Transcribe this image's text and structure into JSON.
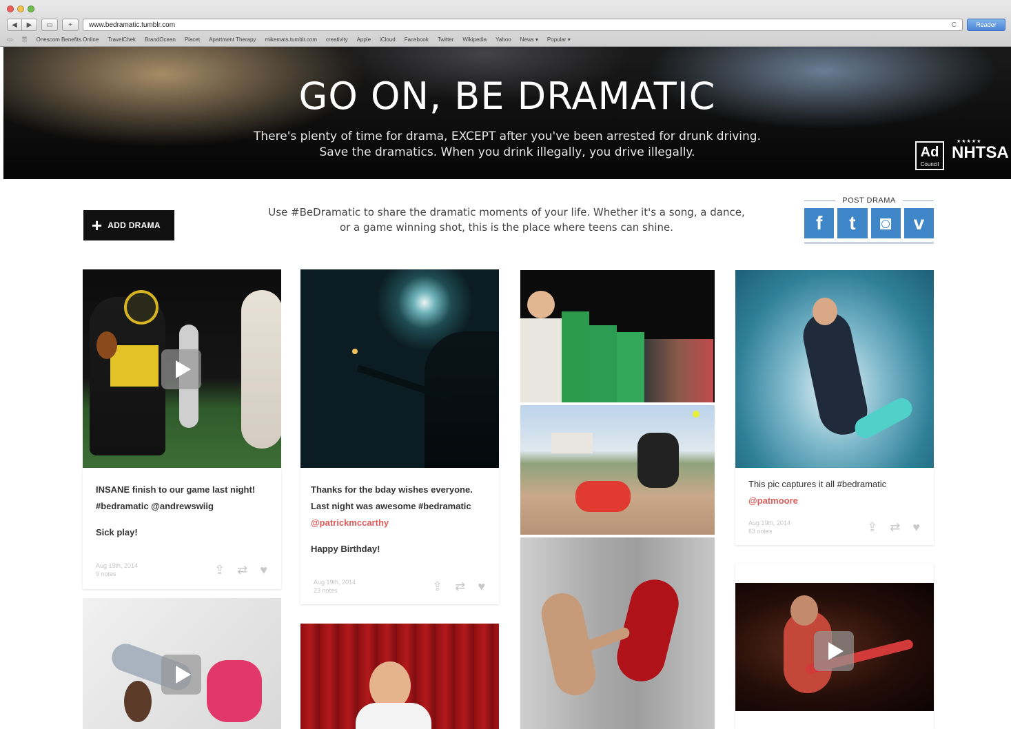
{
  "browser": {
    "url": "www.bedramatic.tumblr.com",
    "reader": "Reader",
    "bookmarks": [
      "Onescom Benefits Online",
      "TravelChek",
      "BrandOcean",
      "Placet",
      "Apartment Therapy",
      "mikemats.tumblr.com",
      "creativity",
      "Apple",
      "iCloud",
      "Facebook",
      "Twitter",
      "Wikipedia",
      "Yahoo",
      "News ▾",
      "Popular ▾"
    ]
  },
  "hero": {
    "title": "GO ON, BE DRAMATIC",
    "line1": "There's plenty of time for drama, EXCEPT after you've been arrested for drunk driving.",
    "line2": "Save the dramatics. When you drink illegally, you drive illegally.",
    "logo_ad": "Ad",
    "logo_council": "Council",
    "logo_nhtsa": "NHTSA",
    "logo_stars": "★★★★★"
  },
  "toolbar": {
    "add_label": "ADD DRAMA",
    "intro_1": "Use #BeDramatic to share the dramatic moments of your life. Whether it's a song, a dance,",
    "intro_2": "or a game winning shot, this is the place where teens can shine.",
    "post_title": "POST DRAMA",
    "social": [
      "f",
      "t",
      "◙",
      "v"
    ]
  },
  "posts": {
    "football": {
      "line1": "INSANE finish to our game last night!",
      "line2": "#bedramatic @andrewswiig",
      "note": "Sick play!",
      "date": "Aug 19th, 2014",
      "notes": "9 notes"
    },
    "guitar": {
      "line1": "Thanks for the bday wishes everyone.",
      "line2": "Last night was awesome #bedramatic",
      "user": "@patrickmccarthy",
      "note": "Happy Birthday!",
      "date": "Aug 19th, 2014",
      "notes": "23 notes"
    },
    "surf": {
      "line1": "This pic captures it all #bedramatic",
      "user": "@patmoore",
      "date": "Aug 19th, 2014",
      "notes": "63 notes"
    }
  },
  "colors": {
    "accent": "#3f86c8",
    "user_link": "#e05a5a",
    "button": "#111111"
  }
}
